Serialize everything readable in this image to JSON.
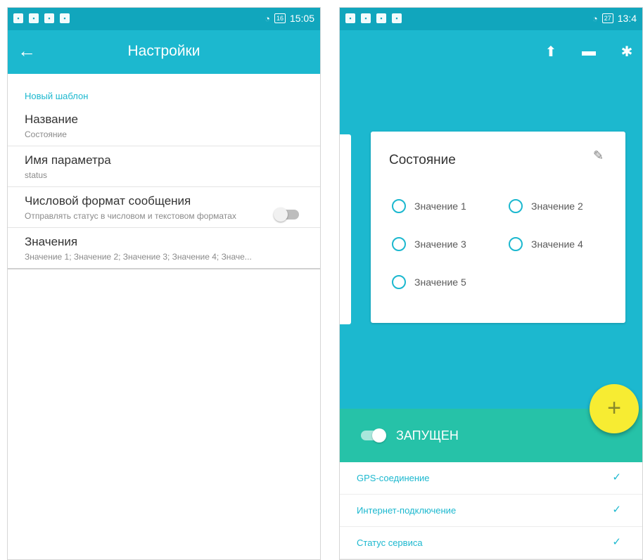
{
  "left": {
    "statusbar": {
      "time": "15:05",
      "battery": "16"
    },
    "toolbar": {
      "title": "Настройки"
    },
    "section_header": "Новый шаблон",
    "prefs": [
      {
        "title": "Название",
        "summary": "Состояние"
      },
      {
        "title": "Имя параметра",
        "summary": "status"
      },
      {
        "title": "Числовой формат сообщения",
        "summary": "Отправлять статус в числовом и текстовом форматах",
        "toggle": false
      },
      {
        "title": "Значения",
        "summary": "Значение 1; Значение 2; Значение 3; Значение 4; Значе..."
      }
    ]
  },
  "right": {
    "statusbar": {
      "time": "13:4",
      "battery": "27"
    },
    "card": {
      "title": "Состояние",
      "options": [
        "Значение 1",
        "Значение 2",
        "Значение 3",
        "Значение 4",
        "Значение 5"
      ]
    },
    "running": {
      "label": "ЗАПУЩЕН",
      "enabled": true
    },
    "fab_label": "+",
    "status_items": [
      {
        "label": "GPS-соединение",
        "ok": true
      },
      {
        "label": "Интернет-подключение",
        "ok": true
      },
      {
        "label": "Статус сервиса",
        "ok": true
      }
    ]
  },
  "colors": {
    "primary": "#1cb8cf",
    "primary_dark": "#11a6bd",
    "running": "#26c2a8",
    "fab": "#f7ec32"
  },
  "icons": [
    "back-arrow-icon",
    "upload-icon",
    "video-icon",
    "settings-gear-icon",
    "edit-pencil-icon",
    "check-icon",
    "plus-icon"
  ]
}
